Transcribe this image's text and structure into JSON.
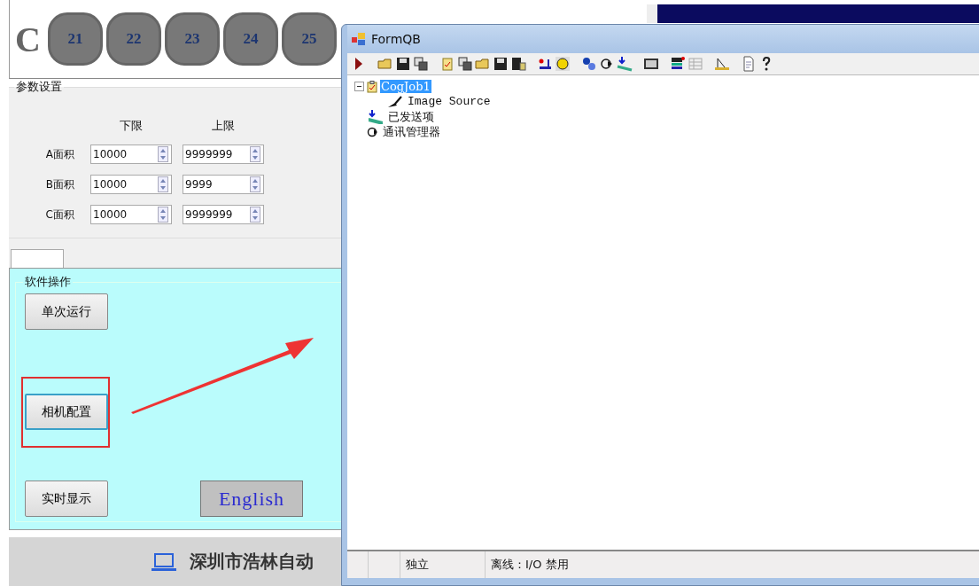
{
  "left_app": {
    "channel_letter": "C",
    "channels": [
      "21",
      "22",
      "23",
      "24",
      "25"
    ],
    "params": {
      "title": "参数设置",
      "columns": [
        "下限",
        "上限"
      ],
      "rows": [
        {
          "label": "A面积",
          "min": "10000",
          "max": "9999999"
        },
        {
          "label": "B面积",
          "min": "10000",
          "max": "9999"
        },
        {
          "label": "C面积",
          "min": "10000",
          "max": "9999999"
        }
      ]
    },
    "tabs": [
      {
        "selected": true
      }
    ],
    "operations": {
      "title": "软件操作",
      "buttons": [
        {
          "label": "单次运行",
          "kind": "plain",
          "focused": false
        },
        {
          "label": "相机配置",
          "kind": "plain",
          "focused": true
        },
        {
          "label": "实时显示",
          "kind": "plain",
          "focused": false
        },
        {
          "label": "English",
          "kind": "language",
          "focused": false
        }
      ]
    },
    "footer": {
      "company": "深圳市浩林自动"
    }
  },
  "window": {
    "title": "FormQB",
    "tree": [
      {
        "label": "CogJob1",
        "kind": "job",
        "selected": true,
        "expanded": true,
        "children": [
          {
            "label": "Image Source",
            "kind": "tool",
            "selected": false
          }
        ]
      },
      {
        "label": "已发送项",
        "kind": "sent",
        "selected": false
      },
      {
        "label": "通讯管理器",
        "kind": "comm",
        "selected": false
      }
    ],
    "status_bar": [
      "独立",
      "离线：I/O 禁用"
    ]
  }
}
